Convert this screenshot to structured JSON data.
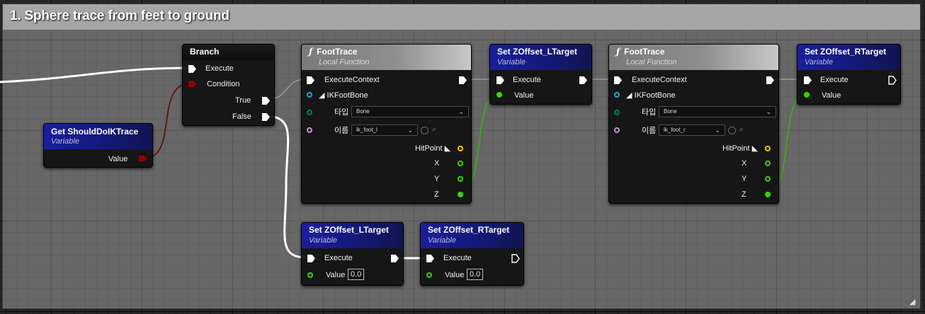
{
  "comment": {
    "title": "1. Sphere trace from feet to ground"
  },
  "nodes": {
    "branch": {
      "title": "Branch",
      "execute": "Execute",
      "condition": "Condition",
      "true": "True",
      "false": "False"
    },
    "get_should_do_ik": {
      "title": "Get ShouldDoIKTrace",
      "subtitle": "Variable",
      "value": "Value"
    },
    "foot_trace_l": {
      "title": "FootTrace",
      "subtitle": "Local Function",
      "execute_context": "ExecuteContext",
      "ik_foot_bone": "IKFootBone",
      "type_label": "타입",
      "type_value": "Bone",
      "name_label": "이름",
      "name_value": "ik_foot_l",
      "hitpoint": "HitPoint",
      "x": "X",
      "y": "Y",
      "z": "Z"
    },
    "set_zoffset_l_top": {
      "title": "Set ZOffset_LTarget",
      "subtitle": "Variable",
      "execute": "Execute",
      "value": "Value"
    },
    "foot_trace_r": {
      "title": "FootTrace",
      "subtitle": "Local Function",
      "execute_context": "ExecuteContext",
      "ik_foot_bone": "IKFootBone",
      "type_label": "타입",
      "type_value": "Bone",
      "name_label": "이름",
      "name_value": "ik_foot_r",
      "hitpoint": "HitPoint",
      "x": "X",
      "y": "Y",
      "z": "Z"
    },
    "set_zoffset_r_top": {
      "title": "Set ZOffset_RTarget",
      "subtitle": "Variable",
      "execute": "Execute",
      "value": "Value"
    },
    "set_zoffset_l_bottom": {
      "title": "Set ZOffset_LTarget",
      "subtitle": "Variable",
      "execute": "Execute",
      "value": "Value",
      "value_input": "0.0"
    },
    "set_zoffset_r_bottom": {
      "title": "Set ZOffset_RTarget",
      "subtitle": "Variable",
      "execute": "Execute",
      "value": "Value",
      "value_input": "0.0"
    }
  },
  "icons": {
    "function": "function-icon",
    "exec_pin": "exec-pin-icon",
    "float_pin": "float-pin-icon",
    "bool_pin": "bool-pin-icon",
    "struct_pin": "struct-pin-icon",
    "dropdown": "chevron-down-icon",
    "search": "search-icon",
    "browse": "browse-icon",
    "resize": "resize-grip-icon"
  },
  "colors": {
    "exec": "#ffffff",
    "float": "#38d500",
    "bool": "#940000",
    "struct": "#1ca9d6",
    "vector": "#f6c900",
    "name": "#c98dd6",
    "enum": "#007a6a",
    "variable_header": "#1a1f9a"
  }
}
